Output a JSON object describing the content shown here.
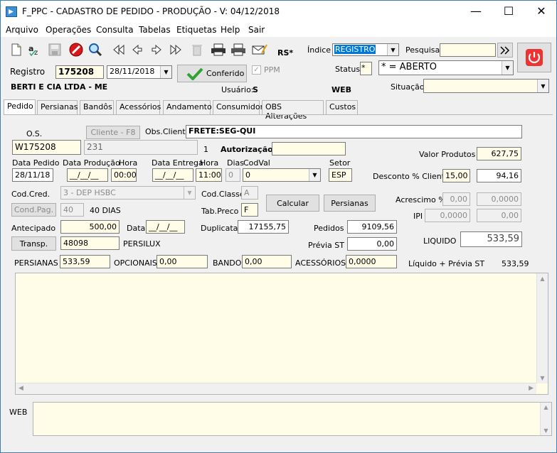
{
  "window": {
    "title": "F_PPC - CADASTRO DE PEDIDO - PRODUÇÃO - V: 04/12/2018",
    "minimize": "—",
    "maximize": "☐",
    "close": "✕"
  },
  "menu": [
    "Arquivo",
    "Operações",
    "Consulta",
    "Tabelas",
    "Etiquetas",
    "Help",
    "Sair"
  ],
  "toolbar": {
    "rs": "RS*",
    "indice_label": "Índice",
    "indice_value": "REGISTRO",
    "pesquisa_label": "Pesquisa",
    "status_label": "Status",
    "status_code": "*",
    "status_value": "* = ABERTO",
    "situacao_label": "Situação"
  },
  "header": {
    "registro_label": "Registro",
    "registro": "175208",
    "date": "28/11/2018",
    "conferido": "Conferido",
    "ppm": "PPM",
    "cliente": "BERTI E CIA LTDA - ME",
    "usuario_label": "Usuário:",
    "usuario": "S",
    "web": "WEB"
  },
  "tabs": [
    "Pedido",
    "Persianas",
    "Bandôs",
    "Acessórios",
    "Andamento",
    "Consumidor",
    "OBS Alterações",
    "Custos"
  ],
  "form": {
    "os_label": "O.S.",
    "cliente_btn": "Cliente - F8",
    "obs_cliente_label": "Obs.Cliente",
    "obs_cliente": "FRETE:SEG-QUI",
    "os": "W175208",
    "cliente_code": "231",
    "count": "1",
    "autorizacao_label": "Autorização",
    "data_pedido_label": "Data Pedido",
    "data_pedido": "28/11/18",
    "data_producao_label": "Data Produção",
    "data_producao": "__/__/__",
    "hora_label": "Hora",
    "hora1": "00:00",
    "data_entrega_label": "Data Entrega",
    "data_entrega": "__/__/__",
    "hora2_label": "Hora",
    "hora2": "11:00",
    "dias_label": "Dias",
    "dias": "0",
    "codval_label": "CodVal",
    "codval": "0",
    "setor_label": "Setor",
    "setor": "ESP",
    "valor_produtos_label": "Valor Produtos",
    "valor_produtos": "627,75",
    "desconto_label": "Desconto % Cliente",
    "desconto_pct": "15,00",
    "desconto_val": "94,16",
    "codcred_label": "Cod.Cred.",
    "codcred": "3 - DEP HSBC",
    "codclasse_label": "Cod.Classe",
    "codclasse": "A",
    "calcular": "Calcular",
    "persianas_btn": "Persianas",
    "acrescimo_label": "Acrescimo %",
    "acrescimo_pct": "0,00",
    "acrescimo_val": "0,0000",
    "condpag_btn": "Cond.Pag.",
    "condpag": "40",
    "condpag_text": "40 DIAS",
    "tabpreco_label": "Tab.Preco",
    "tabpreco": "F",
    "ipi_label": "IPI",
    "ipi_pct": "0,0000",
    "ipi_val": "0,00",
    "antecipado_label": "Antecipado",
    "antecipado": "500,00",
    "data_label": "Data",
    "data": "__/__/__",
    "duplicatas_label": "Duplicatas",
    "duplicatas": "17155,75",
    "pedidos_label": "Pedidos",
    "pedidos": "9109,56",
    "liquido_label": "LIQUIDO",
    "liquido": "533,59",
    "transp_btn": "Transp.",
    "transp_code": "48098",
    "transp_name": "PERSILUX",
    "previa_label": "Prévia ST",
    "previa": "0,00",
    "persianas_label": "PERSIANAS",
    "persianas": "533,59",
    "opcionais_label": "OPCIONAIS",
    "opcionais": "0,00",
    "bando_label": "BANDO",
    "bando": "0,00",
    "acessorios_label": "ACESSÓRIOS",
    "acessorios": "0,0000",
    "liq_previa_label": "Líquido + Prévia ST",
    "liq_previa": "533,59",
    "web_label": "WEB"
  }
}
